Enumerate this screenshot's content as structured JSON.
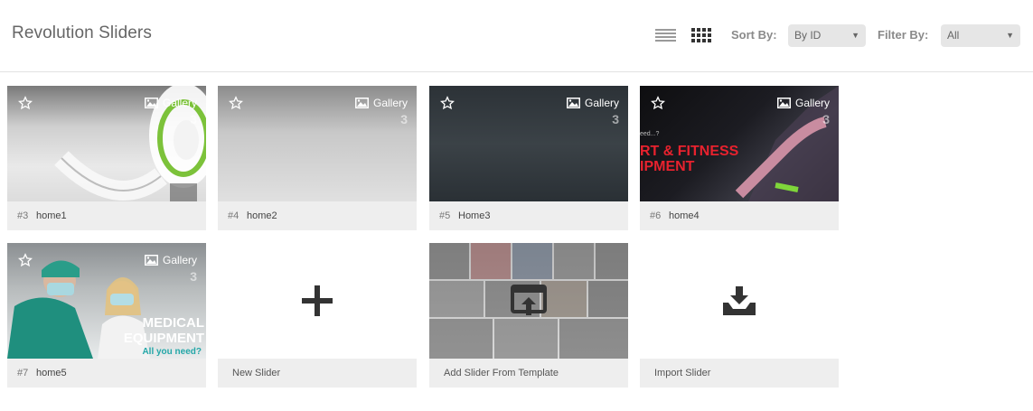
{
  "header": {
    "title": "Revolution Sliders",
    "sort_label": "Sort By:",
    "sort_value": "By ID",
    "filter_label": "Filter By:",
    "filter_value": "All"
  },
  "sliders": [
    {
      "id": "#3",
      "name": "home1",
      "type_label": "Gallery",
      "slide_count": "3"
    },
    {
      "id": "#4",
      "name": "home2",
      "type_label": "Gallery",
      "slide_count": "3"
    },
    {
      "id": "#5",
      "name": "Home3",
      "type_label": "Gallery",
      "slide_count": "3"
    },
    {
      "id": "#6",
      "name": "home4",
      "type_label": "Gallery",
      "slide_count": "3"
    },
    {
      "id": "#7",
      "name": "home5",
      "type_label": "Gallery",
      "slide_count": "3"
    }
  ],
  "thumbnail_text": {
    "fitness_line1": "RT & FITNESS",
    "fitness_line2": "IPMENT",
    "fitness_small": "eed...?",
    "medical_line1": "MEDICAL",
    "medical_line2": "EQUIPMENT",
    "medical_line3": "All you need?"
  },
  "actions": {
    "new_slider": "New Slider",
    "add_from_template": "Add Slider From Template",
    "import_slider": "Import Slider"
  },
  "colors": {
    "accent_green": "#7cc23a",
    "fitness_red": "#e8222e",
    "medical_teal": "#24a7a8"
  }
}
